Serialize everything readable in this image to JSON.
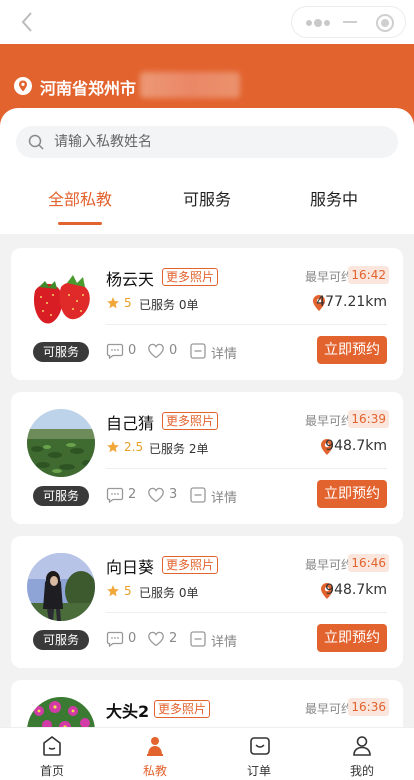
{
  "location": {
    "text": "河南省郑州市"
  },
  "search": {
    "placeholder": "请输入私教姓名"
  },
  "tabs": [
    {
      "label": "全部私教",
      "active": true
    },
    {
      "label": "可服务",
      "active": false
    },
    {
      "label": "服务中",
      "active": false
    }
  ],
  "card_labels": {
    "more_photos": "更多照片",
    "earliest": "最早可约",
    "details": "详情",
    "book": "立即预约"
  },
  "coaches": [
    {
      "name": "杨云天",
      "time": "16:42",
      "rating": "5",
      "served": "已服务 0单",
      "distance": "477.21km",
      "status": "可服务",
      "comments": "0",
      "likes": "0",
      "avatar": "strawberry"
    },
    {
      "name": "自己猜",
      "time": "16:39",
      "rating": "2.5",
      "served": "已服务 2单",
      "distance": "948.7km",
      "status": "可服务",
      "comments": "2",
      "likes": "3",
      "avatar": "field"
    },
    {
      "name": "向日葵",
      "time": "16:46",
      "rating": "5",
      "served": "已服务 0单",
      "distance": "948.7km",
      "status": "可服务",
      "comments": "0",
      "likes": "2",
      "avatar": "person"
    },
    {
      "name": "大头2",
      "time": "16:36",
      "avatar": "flowers"
    }
  ],
  "tabbar": [
    {
      "label": "首页",
      "icon": "home-icon",
      "active": false
    },
    {
      "label": "私教",
      "icon": "coach-icon",
      "active": true
    },
    {
      "label": "订单",
      "icon": "order-icon",
      "active": false
    },
    {
      "label": "我的",
      "icon": "profile-icon",
      "active": false
    }
  ],
  "colors": {
    "accent": "#e2632e",
    "status_tag": "#3a3a3a",
    "time_bg": "#fbe6dd",
    "star": "#f2a93b"
  }
}
